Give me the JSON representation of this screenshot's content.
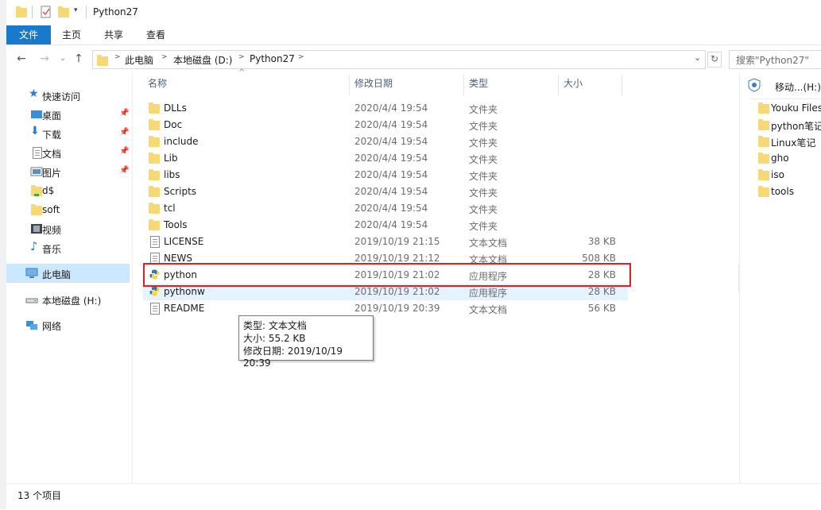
{
  "window": {
    "title": "Python27"
  },
  "ribbon": {
    "tabs": [
      "文件",
      "主页",
      "共享",
      "查看"
    ]
  },
  "address": {
    "segments": [
      "此电脑",
      "本地磁盘 (D:)",
      "Python27"
    ]
  },
  "search": {
    "placeholder": "搜索\"Python27\""
  },
  "nav": {
    "items": [
      {
        "label": "快速访问",
        "icon": "star-icon"
      },
      {
        "label": "桌面",
        "icon": "desktop-icon",
        "pinned": true
      },
      {
        "label": "下载",
        "icon": "download-icon",
        "pinned": true
      },
      {
        "label": "文档",
        "icon": "document-icon",
        "pinned": true
      },
      {
        "label": "图片",
        "icon": "picture-icon",
        "pinned": true
      },
      {
        "label": "d$",
        "icon": "network-folder-icon"
      },
      {
        "label": "soft",
        "icon": "folder-icon"
      },
      {
        "label": "视频",
        "icon": "video-icon"
      },
      {
        "label": "音乐",
        "icon": "music-icon"
      },
      {
        "label": "此电脑",
        "icon": "pc-icon",
        "selected": true
      },
      {
        "label": "本地磁盘 (H:)",
        "icon": "drive-icon"
      },
      {
        "label": "网络",
        "icon": "network-icon"
      }
    ]
  },
  "columns": {
    "name": "名称",
    "date": "修改日期",
    "type": "类型",
    "size": "大小"
  },
  "files": [
    {
      "name": "DLLs",
      "date": "2020/4/4 19:54",
      "type": "文件夹",
      "size": "",
      "kind": "folder"
    },
    {
      "name": "Doc",
      "date": "2020/4/4 19:54",
      "type": "文件夹",
      "size": "",
      "kind": "folder"
    },
    {
      "name": "include",
      "date": "2020/4/4 19:54",
      "type": "文件夹",
      "size": "",
      "kind": "folder"
    },
    {
      "name": "Lib",
      "date": "2020/4/4 19:54",
      "type": "文件夹",
      "size": "",
      "kind": "folder"
    },
    {
      "name": "libs",
      "date": "2020/4/4 19:54",
      "type": "文件夹",
      "size": "",
      "kind": "folder"
    },
    {
      "name": "Scripts",
      "date": "2020/4/4 19:54",
      "type": "文件夹",
      "size": "",
      "kind": "folder"
    },
    {
      "name": "tcl",
      "date": "2020/4/4 19:54",
      "type": "文件夹",
      "size": "",
      "kind": "folder"
    },
    {
      "name": "Tools",
      "date": "2020/4/4 19:54",
      "type": "文件夹",
      "size": "",
      "kind": "folder"
    },
    {
      "name": "LICENSE",
      "date": "2019/10/19 21:15",
      "type": "文本文档",
      "size": "38 KB",
      "kind": "doc"
    },
    {
      "name": "NEWS",
      "date": "2019/10/19 21:12",
      "type": "文本文档",
      "size": "508 KB",
      "kind": "doc"
    },
    {
      "name": "python",
      "date": "2019/10/19 21:02",
      "type": "应用程序",
      "size": "28 KB",
      "kind": "python"
    },
    {
      "name": "pythonw",
      "date": "2019/10/19 21:02",
      "type": "应用程序",
      "size": "28 KB",
      "kind": "python"
    },
    {
      "name": "README",
      "date": "2019/10/19 20:39",
      "type": "文本文档",
      "size": "56 KB",
      "kind": "doc"
    }
  ],
  "tooltip": {
    "line1": "类型: 文本文档",
    "line2": "大小: 55.2 KB",
    "line3": "修改日期: 2019/10/19 20:39"
  },
  "right_panel": {
    "drive": "移动...(H:)",
    "folders": [
      "Youku Files",
      "python笔记",
      "Linux笔记",
      "gho",
      "iso",
      "tools"
    ]
  },
  "status": {
    "count": "13 个项目"
  }
}
